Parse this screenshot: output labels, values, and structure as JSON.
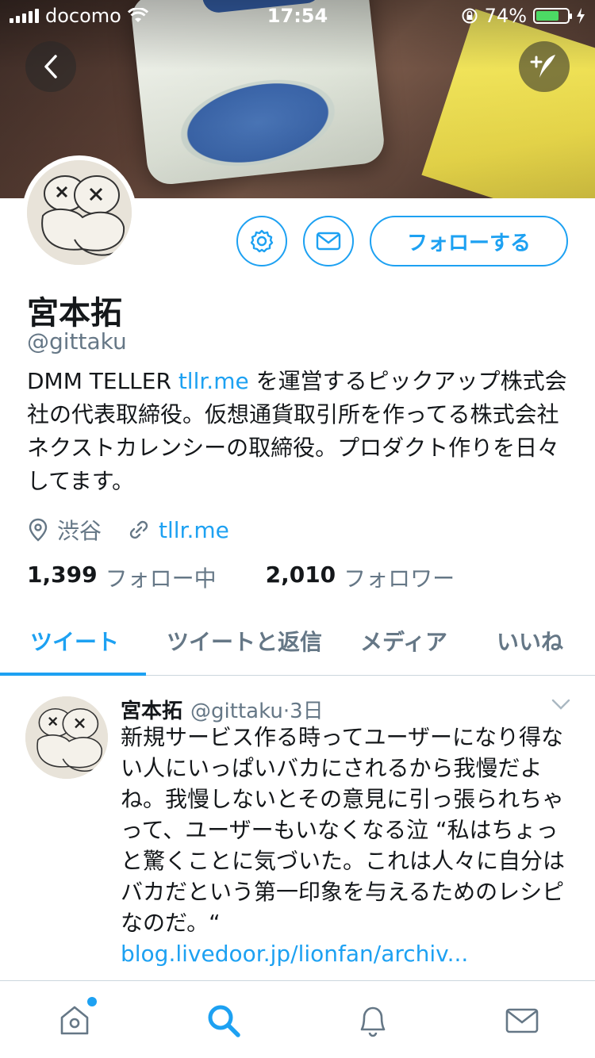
{
  "status_bar": {
    "carrier": "docomo",
    "time": "17:54",
    "battery_percent": "74%",
    "battery_level": 0.74
  },
  "profile": {
    "name": "宮本拓",
    "handle": "@gittaku",
    "bio_prefix": "DMM TELLER ",
    "bio_link": "tllr.me",
    "bio_suffix": " を運営するピックアップ株式会社の代表取締役。仮想通貨取引所を作ってる株式会社ネクストカレンシーの取締役。プロダクト作りを日々してます。",
    "location": "渋谷",
    "website": "tllr.me",
    "following_count": "1,399",
    "following_label": "フォロー中",
    "followers_count": "2,010",
    "followers_label": "フォロワー"
  },
  "actions": {
    "follow_label": "フォローする"
  },
  "tabs": [
    {
      "label": "ツイート",
      "active": true
    },
    {
      "label": "ツイートと返信",
      "active": false
    },
    {
      "label": "メディア",
      "active": false
    },
    {
      "label": "いいね",
      "active": false
    }
  ],
  "tweet": {
    "name": "宮本拓",
    "handle": "@gittaku",
    "separator": "·",
    "time": "3日",
    "text": "新規サービス作る時ってユーザーになり得ない人にいっぱいバカにされるから我慢だよね。我慢しないとその意見に引っ張られちゃって、ユーザーもいなくなる泣 “私はちょっと驚くことに気づいた。これは人々に自分はバカだという第一印象を与えるためのレシピなのだ。“",
    "link": "blog.livedoor.jp/lionfan/archiv..."
  },
  "colors": {
    "accent": "#1da1f2",
    "secondary_text": "#657786",
    "primary_text": "#14171a",
    "divider": "#ccd6dd"
  },
  "icons": [
    "back-icon",
    "compose-icon",
    "settings-icon",
    "message-icon",
    "location-icon",
    "link-icon",
    "chevron-down-icon",
    "home-icon",
    "search-icon",
    "notifications-icon",
    "messages-icon"
  ]
}
